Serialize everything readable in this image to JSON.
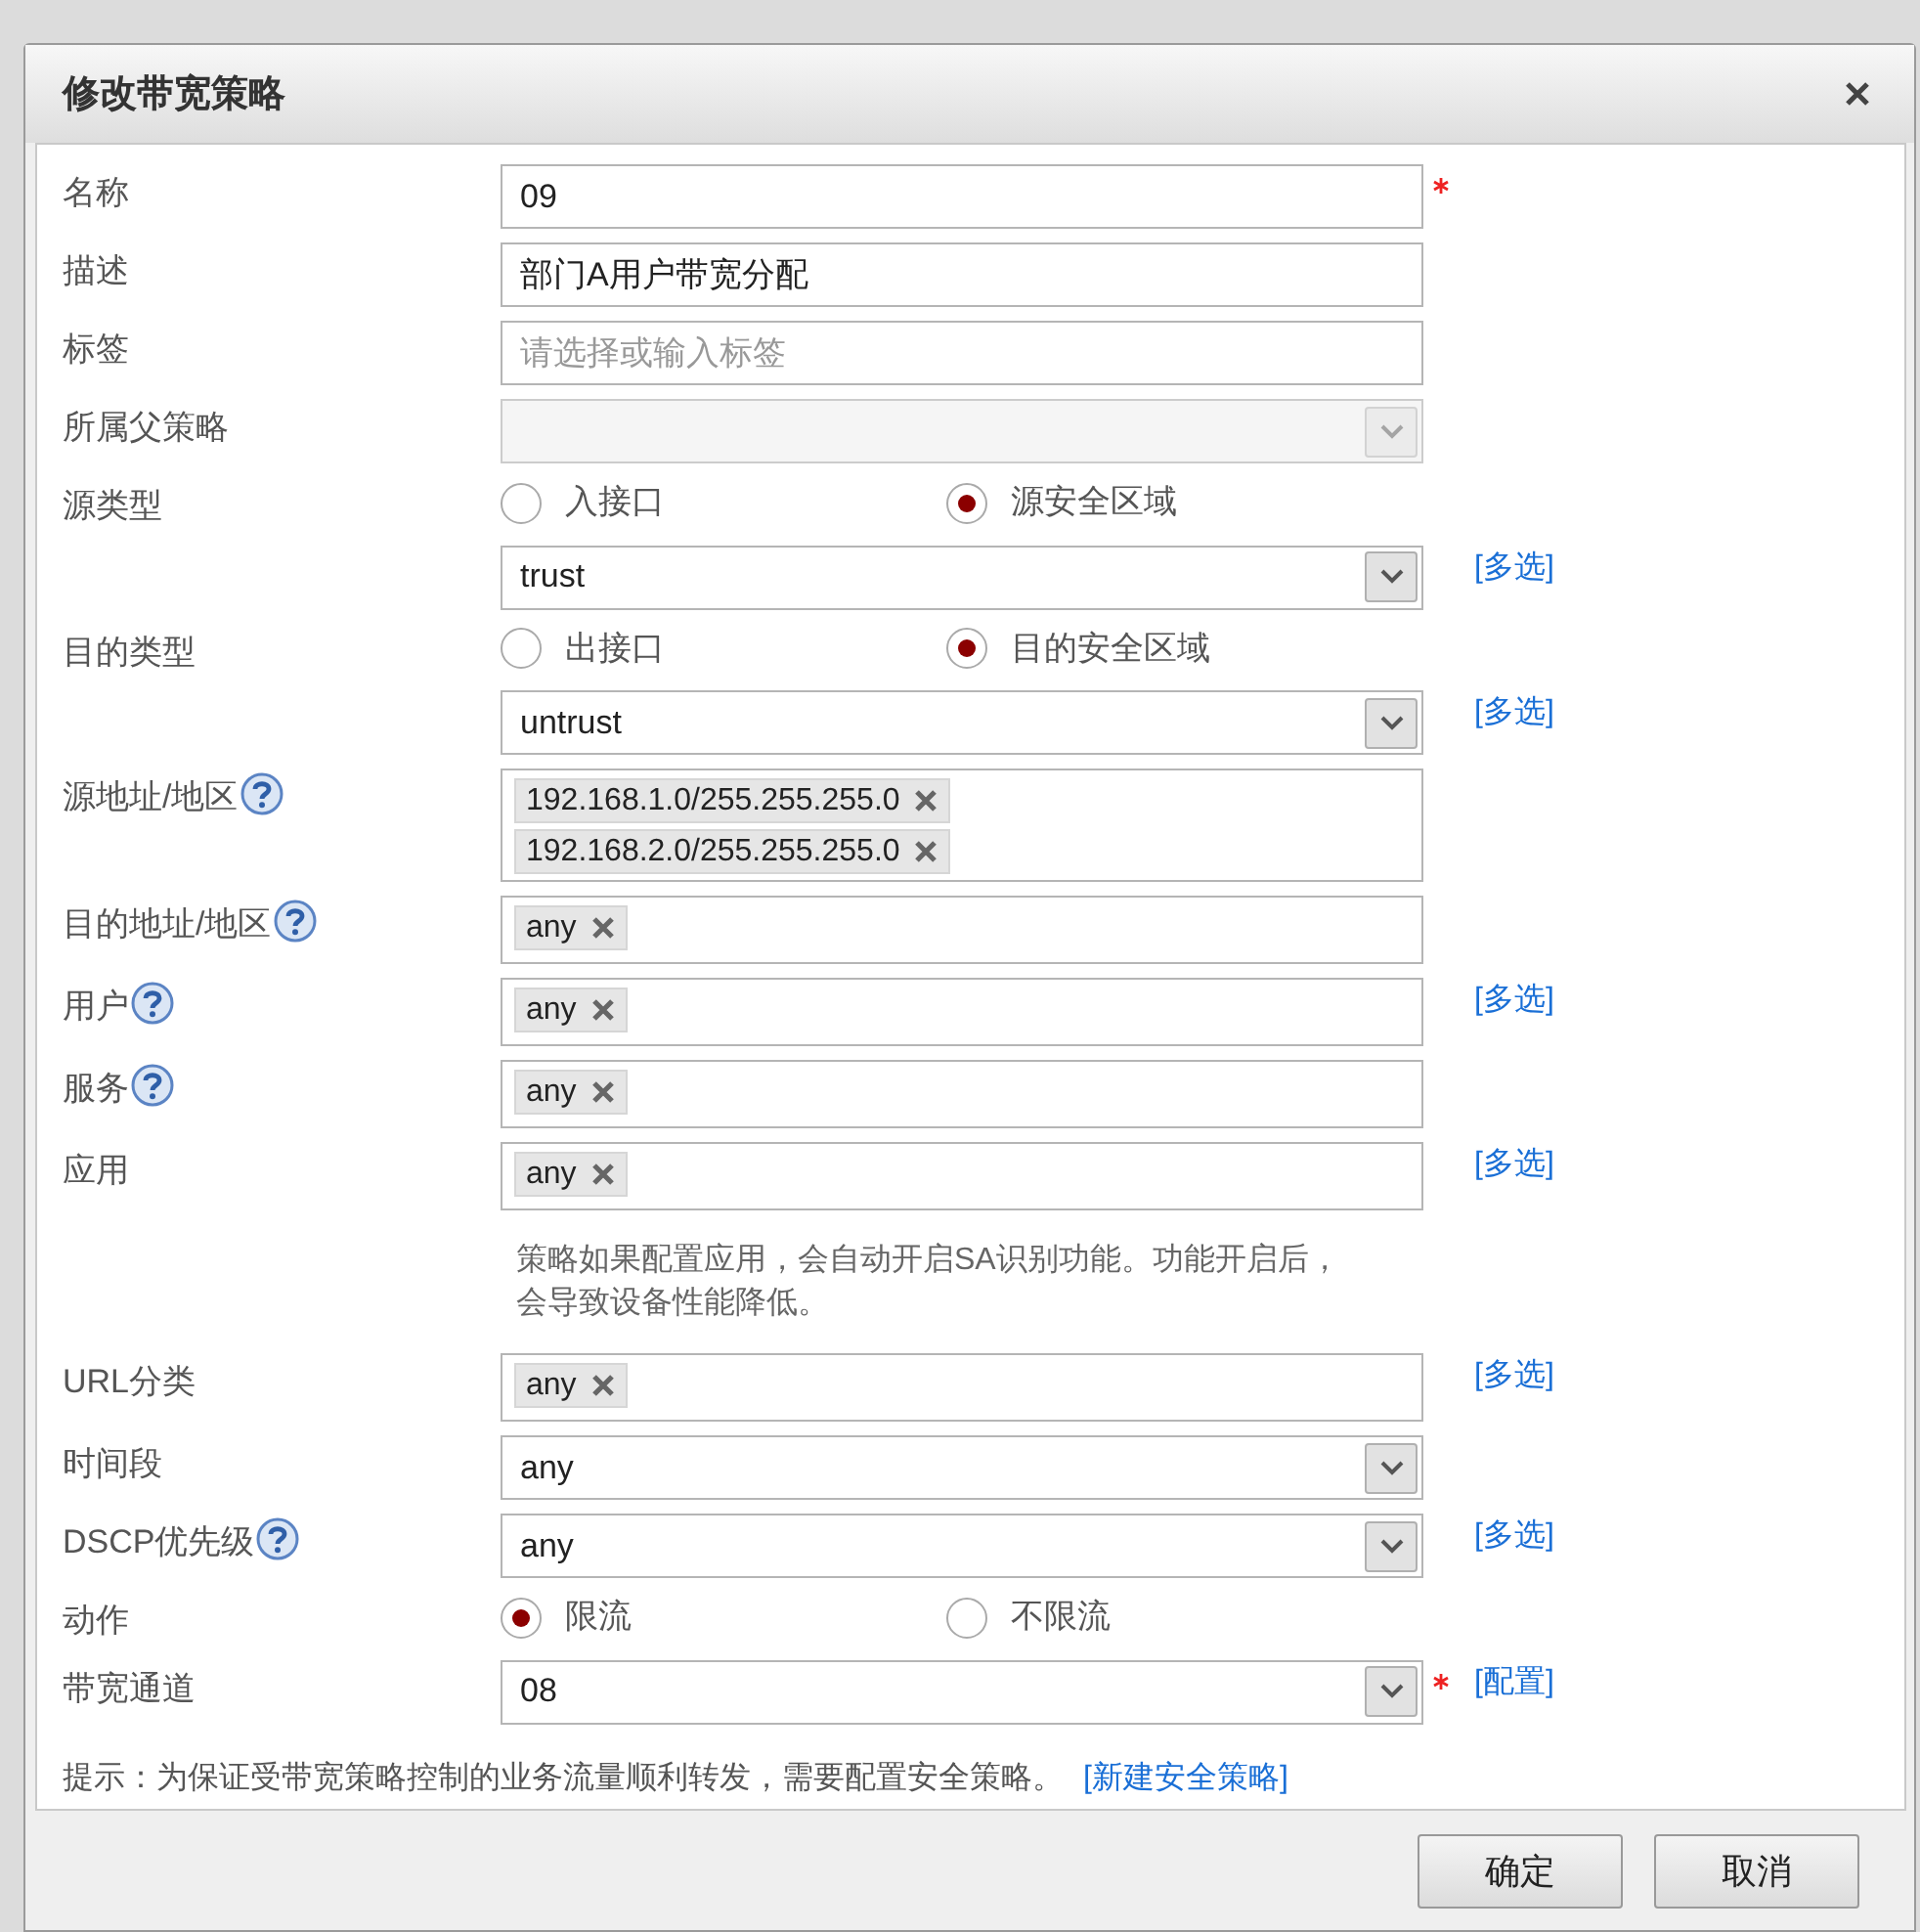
{
  "dialog": {
    "title": "修改带宽策略"
  },
  "fields": [
    {
      "kind": "text",
      "label": "名称",
      "value": "09",
      "required": true
    },
    {
      "kind": "text",
      "label": "描述",
      "value": "部门A用户带宽分配"
    },
    {
      "kind": "text",
      "label": "标签",
      "placeholder": "请选择或输入标签"
    },
    {
      "kind": "select",
      "label": "所属父策略",
      "disabled": true
    },
    {
      "kind": "radio",
      "label": "源类型",
      "options": [
        {
          "label": "入接口",
          "selected": false
        },
        {
          "label": "源安全区域",
          "selected": true
        }
      ]
    },
    {
      "kind": "select",
      "value": "trust",
      "link": "[多选]"
    },
    {
      "kind": "radio",
      "label": "目的类型",
      "options": [
        {
          "label": "出接口",
          "selected": false
        },
        {
          "label": "目的安全区域",
          "selected": true
        }
      ]
    },
    {
      "kind": "select",
      "value": "untrust",
      "link": "[多选]"
    },
    {
      "kind": "tags",
      "label": "源地址/地区",
      "help": true,
      "tags": [
        "192.168.1.0/255.255.255.0",
        "192.168.2.0/255.255.255.0"
      ]
    },
    {
      "kind": "tags",
      "label": "目的地址/地区",
      "help": true,
      "tags": [
        "any"
      ]
    },
    {
      "kind": "tags",
      "label": "用户",
      "help": true,
      "tags": [
        "any"
      ],
      "link": "[多选]"
    },
    {
      "kind": "tags",
      "label": "服务",
      "help": true,
      "tags": [
        "any"
      ]
    },
    {
      "kind": "tags",
      "label": "应用",
      "tags": [
        "any"
      ],
      "link": "[多选]"
    },
    {
      "kind": "note",
      "text": "策略如果配置应用，会自动开启SA识别功能。功能开启后，会导致设备性能降低。"
    },
    {
      "kind": "tags",
      "label": "URL分类",
      "tags": [
        "any"
      ],
      "link": "[多选]"
    },
    {
      "kind": "select",
      "label": "时间段",
      "value": "any"
    },
    {
      "kind": "select",
      "label": "DSCP优先级",
      "help": true,
      "value": "any",
      "link": "[多选]"
    },
    {
      "kind": "radio",
      "label": "动作",
      "options": [
        {
          "label": "限流",
          "selected": true
        },
        {
          "label": "不限流",
          "selected": false
        }
      ]
    },
    {
      "kind": "select",
      "label": "带宽通道",
      "value": "08",
      "required": true,
      "link": "[配置]"
    }
  ],
  "hint": {
    "text": "提示：为保证受带宽策略控制的业务流量顺利转发，需要配置安全策略。",
    "link": "[新建安全策略]"
  },
  "buttons": [
    "确定",
    "取消"
  ]
}
